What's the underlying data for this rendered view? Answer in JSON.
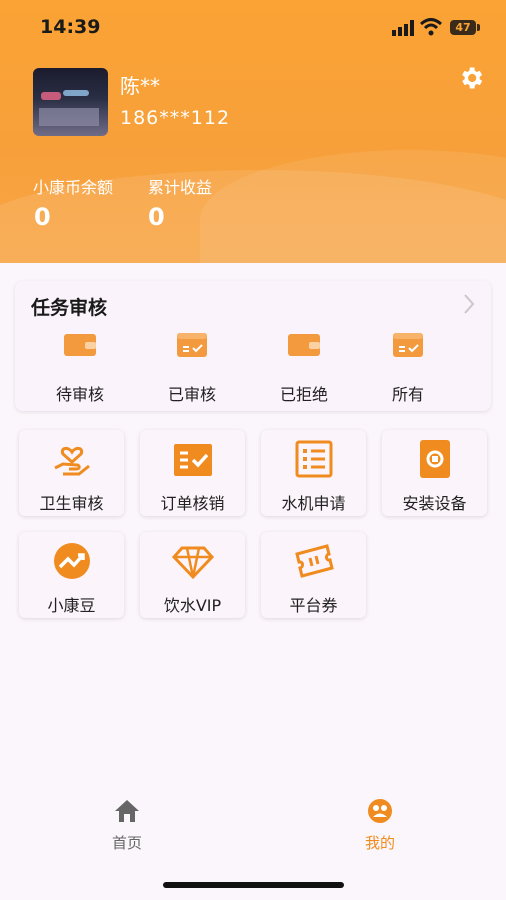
{
  "status_bar": {
    "time": "14:39",
    "battery": "47"
  },
  "profile": {
    "name": "陈**",
    "phone": "186***112"
  },
  "stats": [
    {
      "label": "小康币余额",
      "value": "0"
    },
    {
      "label": "累计收益",
      "value": "0"
    }
  ],
  "task_review": {
    "title": "任务审核",
    "items": [
      {
        "label": "待审核",
        "icon": "wallet-icon"
      },
      {
        "label": "已审核",
        "icon": "wallet-check-icon"
      },
      {
        "label": "已拒绝",
        "icon": "wallet-icon"
      },
      {
        "label": "所有",
        "icon": "wallet-check-icon"
      }
    ]
  },
  "grid": [
    {
      "label": "卫生审核",
      "icon": "hand-heart-icon"
    },
    {
      "label": "订单核销",
      "icon": "order-check-icon"
    },
    {
      "label": "水机申请",
      "icon": "list-document-icon"
    },
    {
      "label": "安装设备",
      "icon": "device-install-icon"
    },
    {
      "label": "小康豆",
      "icon": "trend-chart-icon"
    },
    {
      "label": "饮水VIP",
      "icon": "diamond-icon"
    },
    {
      "label": "平台券",
      "icon": "ticket-icon"
    }
  ],
  "tabbar": [
    {
      "label": "首页",
      "icon": "home-icon",
      "active": false
    },
    {
      "label": "我的",
      "icon": "profile-icon",
      "active": true
    }
  ],
  "colors": {
    "accent": "#f5922b",
    "header": "#fba334",
    "inactive": "#666666"
  }
}
